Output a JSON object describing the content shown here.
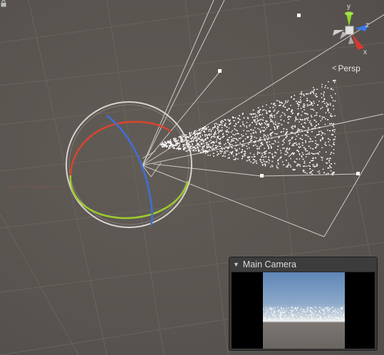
{
  "scene_view": {
    "projection_label": "Persp",
    "gizmo_axes": {
      "y": "y",
      "z": "z",
      "x": "x"
    }
  },
  "camera_preview": {
    "title": "Main Camera"
  },
  "colors": {
    "background": "#5c5652",
    "grid": "#6f6964",
    "frustum": "#c9c4c0",
    "rotation_x": "#d9452c",
    "rotation_y": "#9ccd2c",
    "rotation_z": "#3f6fd8",
    "particles": "#ffffff",
    "gizmo_y": "#8cd72a",
    "gizmo_z": "#3a78e0",
    "gizmo_x": "#d8392c"
  }
}
